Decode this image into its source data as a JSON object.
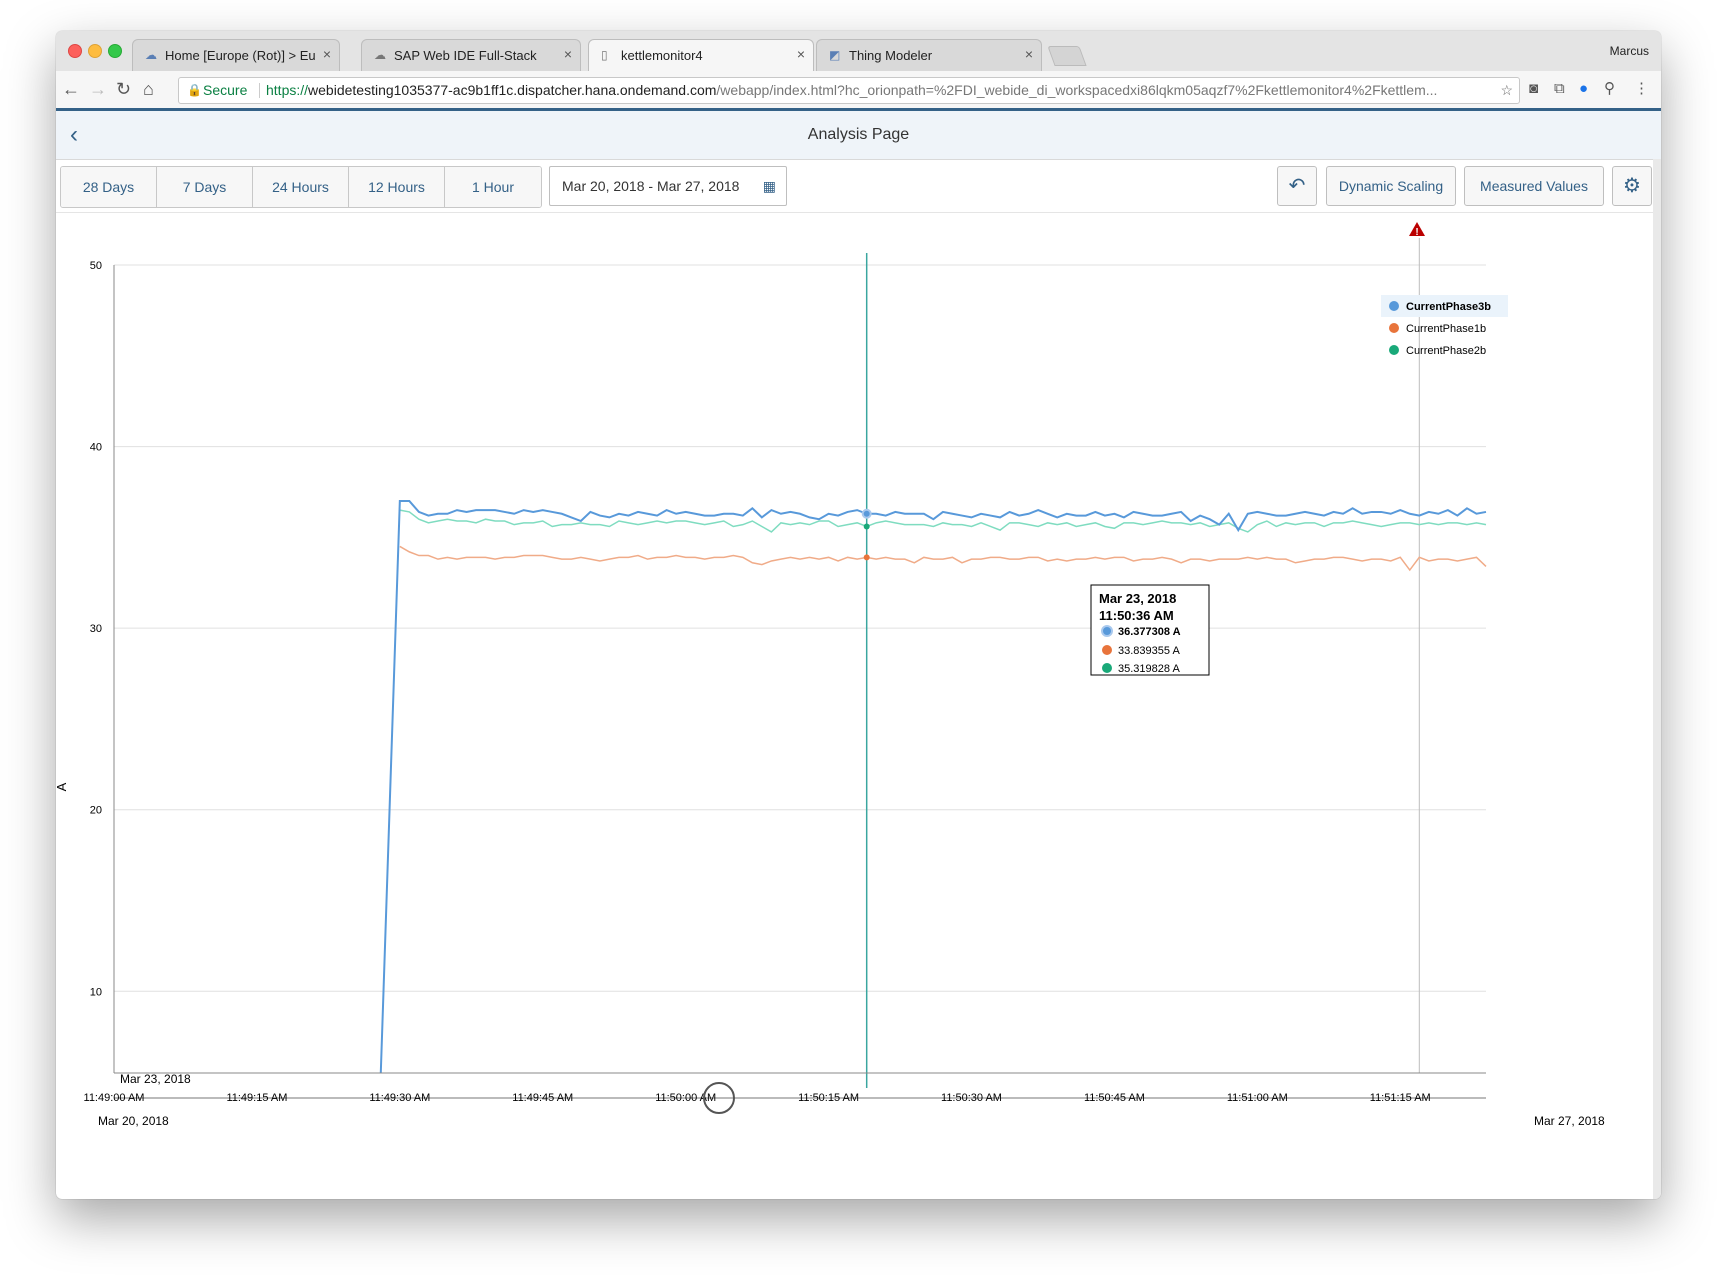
{
  "browser": {
    "tabs": [
      {
        "title": "Home [Europe (Rot)] > Europe",
        "icon": "cloud-icon"
      },
      {
        "title": "SAP Web IDE Full-Stack",
        "icon": "cloud-outline-icon"
      },
      {
        "title": "kettlemonitor4",
        "icon": "document-icon"
      },
      {
        "title": "Thing Modeler",
        "icon": "app-icon"
      }
    ],
    "user": "Marcus",
    "secure_label": "Secure",
    "url_scheme": "https://",
    "url_host": "webidetesting1035377-ac9b1ff1c.dispatcher.hana.ondemand.com",
    "url_path": "/webapp/index.html?hc_orionpath=%2FDI_webide_di_workspacedxi86lqkm05aqzf7%2Fkettlemonitor4%2Fkettlem..."
  },
  "shell": {
    "title": "Analysis Page"
  },
  "toolbar": {
    "ranges": [
      "28 Days",
      "7 Days",
      "24 Hours",
      "12 Hours",
      "1 Hour"
    ],
    "date_range": "Mar 20, 2018 - Mar 27, 2018",
    "dynamic_scaling": "Dynamic Scaling",
    "measured_values": "Measured Values"
  },
  "tooltip": {
    "date": "Mar 23, 2018",
    "time": "11:50:36 AM",
    "values": [
      "36.377308 A",
      "33.839355 A",
      "35.319828 A"
    ]
  },
  "chart_data": {
    "type": "line",
    "ylabel": "A",
    "ylim": [
      5.5,
      50
    ],
    "yticks": [
      10,
      20,
      30,
      40,
      50
    ],
    "x_date_label": "Mar 23, 2018",
    "xticks": [
      "11:49:00 AM",
      "11:49:15 AM",
      "11:49:30 AM",
      "11:49:45 AM",
      "11:50:00 AM",
      "11:50:15 AM",
      "11:50:30 AM",
      "11:50:45 AM",
      "11:51:00 AM",
      "11:51:15 AM"
    ],
    "xlim_seconds": [
      0,
      144
    ],
    "range_start": "Mar 20, 2018",
    "range_end": "Mar 27, 2018",
    "legend_position": "right",
    "series": [
      {
        "name": "CurrentPhase3b",
        "color": "#5899da",
        "first_point": {
          "t": 28,
          "v": 5.5
        },
        "t_start": 30,
        "t_step": 1,
        "t_end": 144,
        "values": [
          37.0,
          37.0,
          36.4,
          36.2,
          36.3,
          36.3,
          36.5,
          36.4,
          36.5,
          36.5,
          36.5,
          36.4,
          36.3,
          36.5,
          36.4,
          36.5,
          36.4,
          36.3,
          36.1,
          35.9,
          36.4,
          36.2,
          36.1,
          36.3,
          36.2,
          36.4,
          36.3,
          36.2,
          36.5,
          36.3,
          36.4,
          36.3,
          36.2,
          36.2,
          36.3,
          36.3,
          36.2,
          36.6,
          36.1,
          36.5,
          36.3,
          36.4,
          36.3,
          36.1,
          36.0,
          36.3,
          36.2,
          36.4,
          36.5,
          36.3,
          36.3,
          36.2,
          36.4,
          36.3,
          36.3,
          36.3,
          36.0,
          36.4,
          36.3,
          36.2,
          36.1,
          36.3,
          36.2,
          36.1,
          36.4,
          36.2,
          36.3,
          36.5,
          36.3,
          36.1,
          36.3,
          36.2,
          36.2,
          36.4,
          36.2,
          36.3,
          36.1,
          36.4,
          36.3,
          36.2,
          36.2,
          36.3,
          36.4,
          35.9,
          36.2,
          36.0,
          35.7,
          36.3,
          35.4,
          36.3,
          36.4,
          36.3,
          36.2,
          36.2,
          36.3,
          36.4,
          36.3,
          36.2,
          36.4,
          36.3,
          36.6,
          36.3,
          36.4,
          36.4,
          36.3,
          36.5,
          36.3,
          36.2,
          36.4,
          36.3,
          36.5,
          36.2,
          36.6,
          36.3,
          36.4
        ]
      },
      {
        "name": "CurrentPhase1b",
        "color": "#e8743b",
        "t_start": 30,
        "t_step": 1,
        "t_end": 144,
        "values": [
          34.5,
          34.2,
          34.0,
          34.0,
          33.8,
          33.9,
          33.8,
          33.9,
          33.9,
          33.9,
          33.8,
          33.9,
          33.9,
          34.0,
          34.0,
          34.0,
          33.9,
          33.8,
          33.8,
          33.9,
          33.8,
          33.7,
          33.8,
          33.9,
          33.9,
          34.0,
          33.8,
          33.9,
          33.9,
          34.0,
          33.9,
          33.9,
          33.8,
          33.9,
          33.9,
          34.0,
          33.9,
          33.6,
          33.5,
          33.7,
          33.8,
          33.9,
          33.8,
          33.9,
          33.8,
          33.9,
          33.7,
          33.9,
          33.8,
          33.9,
          33.8,
          33.9,
          33.8,
          33.8,
          33.6,
          33.9,
          33.8,
          33.8,
          33.9,
          33.6,
          33.8,
          33.8,
          33.9,
          33.9,
          33.8,
          33.8,
          33.9,
          33.9,
          33.7,
          33.8,
          33.7,
          33.8,
          33.8,
          33.9,
          33.8,
          33.9,
          33.9,
          33.7,
          33.8,
          33.8,
          33.9,
          33.8,
          33.6,
          33.8,
          33.8,
          33.7,
          33.8,
          33.8,
          33.8,
          33.9,
          33.8,
          33.9,
          33.8,
          33.8,
          33.6,
          33.7,
          33.8,
          33.8,
          33.9,
          33.9,
          33.8,
          33.7,
          33.8,
          33.8,
          33.7,
          33.9,
          33.2,
          33.9,
          33.7,
          33.8,
          33.8,
          33.7,
          33.8,
          33.9,
          33.4
        ]
      },
      {
        "name": "CurrentPhase2b",
        "color": "#19a979",
        "t_start": 30,
        "t_step": 1,
        "t_end": 144,
        "values": [
          36.5,
          36.4,
          36.0,
          35.8,
          35.9,
          36.0,
          35.9,
          35.9,
          35.8,
          36.0,
          35.9,
          35.9,
          35.7,
          35.8,
          35.8,
          35.9,
          35.6,
          35.7,
          35.7,
          35.8,
          35.7,
          35.7,
          35.6,
          35.9,
          35.8,
          35.7,
          35.8,
          35.9,
          35.8,
          35.9,
          35.9,
          35.8,
          35.7,
          35.8,
          35.9,
          35.6,
          35.7,
          35.9,
          35.6,
          35.3,
          35.8,
          35.7,
          35.8,
          35.7,
          35.9,
          35.9,
          35.6,
          35.7,
          35.8,
          35.6,
          35.8,
          35.9,
          35.8,
          35.7,
          35.7,
          35.7,
          35.6,
          35.8,
          35.7,
          35.7,
          35.6,
          35.8,
          35.6,
          35.4,
          35.8,
          35.8,
          35.7,
          35.6,
          35.8,
          35.7,
          35.8,
          35.6,
          35.7,
          35.8,
          35.6,
          35.5,
          35.8,
          35.8,
          35.7,
          35.8,
          35.9,
          35.8,
          35.8,
          35.7,
          35.8,
          35.6,
          35.7,
          35.8,
          35.5,
          35.3,
          35.7,
          35.9,
          35.6,
          35.8,
          35.7,
          35.8,
          35.8,
          35.6,
          35.8,
          35.8,
          35.9,
          35.8,
          35.7,
          35.6,
          35.7,
          35.8,
          35.8,
          35.7,
          35.8,
          35.7,
          35.8,
          35.8,
          35.7,
          35.8,
          35.7
        ]
      }
    ],
    "crosshair_t": 79,
    "threshold_t": 137
  },
  "colors": {
    "brand": "#346187",
    "alert": "#bb0000"
  }
}
